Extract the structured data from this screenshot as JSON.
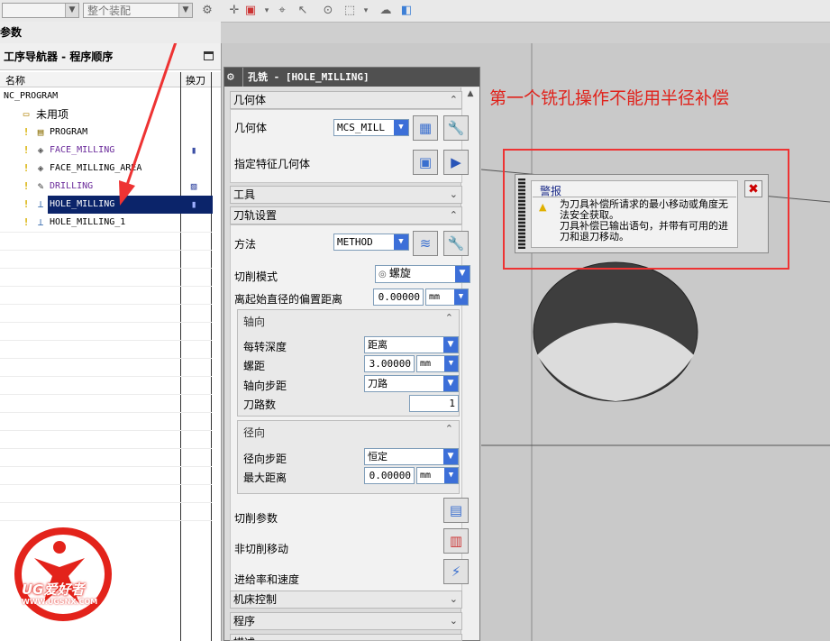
{
  "toolbar": {
    "combo1_value": "",
    "combo2_value": "整个装配"
  },
  "params_strip": {
    "label": "参数"
  },
  "navigator": {
    "title": "工序导航器 - 程序顺序",
    "col_name": "名称",
    "col_tool_change": "换刀",
    "items": [
      {
        "label": "NC_PROGRAM"
      },
      {
        "label": "未用项"
      },
      {
        "label": "PROGRAM"
      },
      {
        "label": "FACE_MILLING"
      },
      {
        "label": "FACE_MILLING_AREA"
      },
      {
        "label": "DRILLING"
      },
      {
        "label": "HOLE_MILLING"
      },
      {
        "label": "HOLE_MILLING_1"
      }
    ]
  },
  "logo": {
    "text": "UG爱好者",
    "url_text": "WWW.UGSNX.COM"
  },
  "caption": "第一个铣孔操作不能用半径补偿",
  "dialog": {
    "title": "孔铣 - [HOLE_MILLING]",
    "sections": {
      "geometry": "几何体",
      "tool": "工具",
      "path_settings": "刀轨设置",
      "machine_control": "机床控制",
      "program": "程序",
      "description": "描述"
    },
    "geometry_label": "几何体",
    "geometry_value": "MCS_MILL",
    "specify_feature_label": "指定特征几何体",
    "method_label": "方法",
    "method_value": "METHOD",
    "cut_mode_label": "切削模式",
    "cut_mode_value": "螺旋",
    "offset_label": "离起始直径的偏置距离",
    "offset_value": "0.00000",
    "offset_unit": "mm",
    "axial": {
      "title": "轴向",
      "depth_per_rev_label": "每转深度",
      "depth_per_rev_value": "距离",
      "pitch_label": "螺距",
      "pitch_value": "3.00000",
      "pitch_unit": "mm",
      "axial_step_label": "轴向步距",
      "axial_step_value": "刀路",
      "passes_label": "刀路数",
      "passes_value": "1"
    },
    "radial": {
      "title": "径向",
      "radial_step_label": "径向步距",
      "radial_step_value": "恒定",
      "max_dist_label": "最大距离",
      "max_dist_value": "0.00000",
      "max_dist_unit": "mm"
    },
    "cutting_params_label": "切削参数",
    "non_cutting_label": "非切削移动",
    "feeds_label": "进给率和速度"
  },
  "alert": {
    "title": "警报",
    "line1": "为刀具补偿所请求的最小移动或角度无法安全获取。",
    "line2": "刀具补偿已输出语句，并带有可用的进刀和退刀移动。"
  }
}
